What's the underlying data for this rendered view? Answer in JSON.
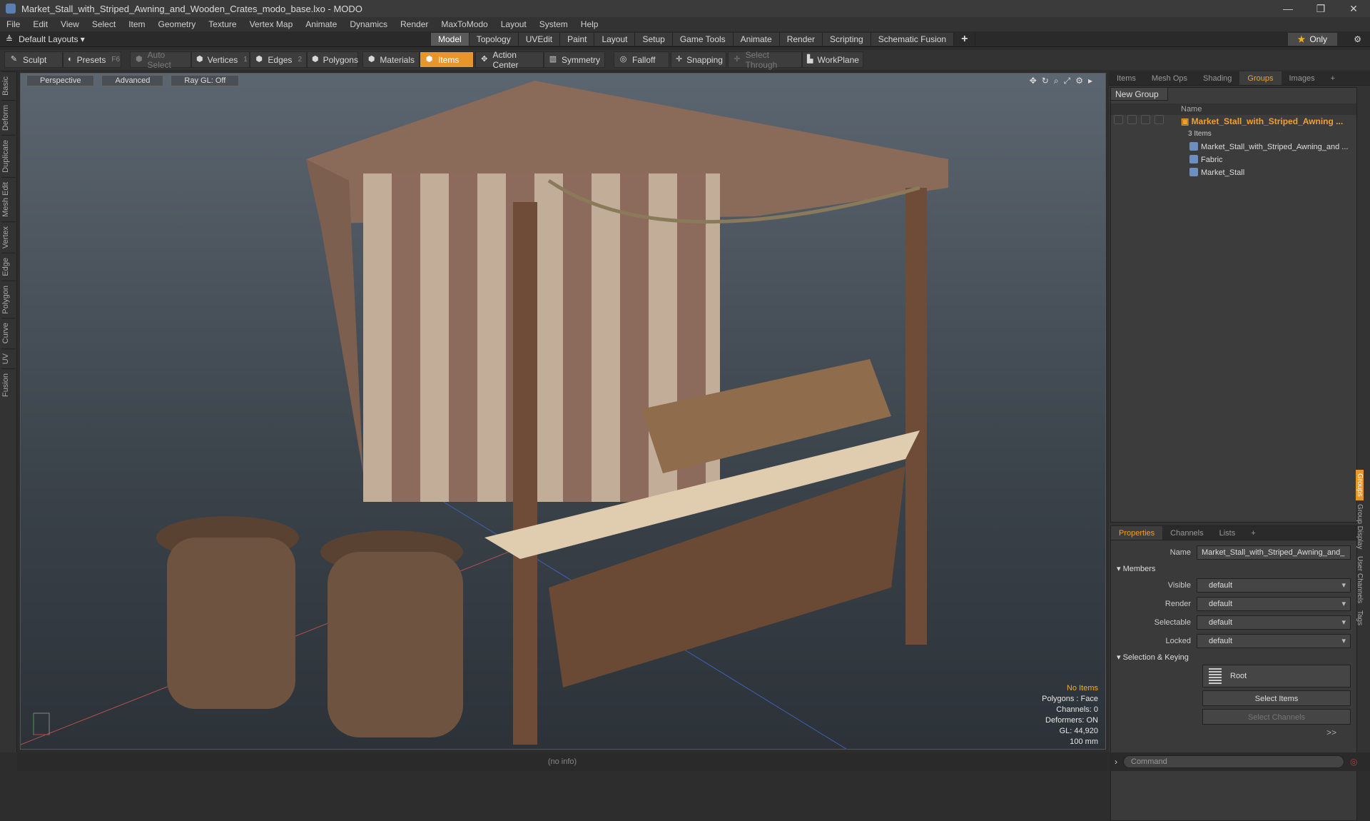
{
  "window": {
    "title": "Market_Stall_with_Striped_Awning_and_Wooden_Crates_modo_base.lxo - MODO",
    "minimize": "—",
    "maximize": "❐",
    "close": "✕"
  },
  "menu": [
    "File",
    "Edit",
    "View",
    "Select",
    "Item",
    "Geometry",
    "Texture",
    "Vertex Map",
    "Animate",
    "Dynamics",
    "Render",
    "MaxToModo",
    "Layout",
    "System",
    "Help"
  ],
  "modebar": {
    "layouts_label": "Default Layouts",
    "tabs": [
      "Model",
      "Topology",
      "UVEdit",
      "Paint",
      "Layout",
      "Setup",
      "Game Tools",
      "Animate",
      "Render",
      "Scripting",
      "Schematic Fusion"
    ],
    "active_tab": "Model",
    "plus": "+",
    "only_label": "Only"
  },
  "toolbar": {
    "sculpt": "Sculpt",
    "presets": "Presets",
    "presets_key": "F6",
    "auto_select": "Auto Select",
    "vertices": "Vertices",
    "vertices_num": "1",
    "edges": "Edges",
    "edges_num": "2",
    "polygons": "Polygons",
    "materials": "Materials",
    "items": "Items",
    "action_center": "Action Center",
    "symmetry": "Symmetry",
    "falloff": "Falloff",
    "snapping": "Snapping",
    "select_through": "Select Through",
    "workplane": "WorkPlane"
  },
  "left_tabs": [
    "Basic",
    "Deform",
    "Duplicate",
    "Mesh Edit",
    "Vertex",
    "Edge",
    "Polygon",
    "Curve",
    "UV",
    "Fusion"
  ],
  "viewport": {
    "buttons": [
      "Perspective",
      "Advanced",
      "Ray GL: Off"
    ],
    "info": {
      "warn": "No Items",
      "lines": [
        "Polygons : Face",
        "Channels: 0",
        "Deformers: ON",
        "GL: 44,920",
        "100 mm"
      ]
    }
  },
  "status": "(no info)",
  "right_panel": {
    "tabs": [
      "Items",
      "Mesh Ops",
      "Shading",
      "Groups",
      "Images",
      "+"
    ],
    "active_tab": "Groups",
    "new_group": "New Group",
    "name_header": "Name",
    "group_name": "Market_Stall_with_Striped_Awning ...",
    "group_count": "3 Items",
    "children": [
      "Market_Stall_with_Striped_Awning_and ...",
      "Fabric",
      "Market_Stall"
    ]
  },
  "props_panel": {
    "tabs": [
      "Properties",
      "Channels",
      "Lists",
      "+"
    ],
    "active_tab": "Properties",
    "name_label": "Name",
    "name_value": "Market_Stall_with_Striped_Awning_and_",
    "members_section": "Members",
    "fields": [
      {
        "label": "Visible",
        "value": "default"
      },
      {
        "label": "Render",
        "value": "default"
      },
      {
        "label": "Selectable",
        "value": "default"
      },
      {
        "label": "Locked",
        "value": "default"
      }
    ],
    "sel_section": "Selection & Keying",
    "root": "Root",
    "select_items": "Select Items",
    "select_channels": "Select Channels",
    "more": ">>"
  },
  "vertical_tabs": [
    "Groups",
    "Group Display",
    "User Channels",
    "Tags"
  ],
  "command_placeholder": "Command",
  "colors": {
    "accent": "#e8962b",
    "selected_text": "#f0a030"
  }
}
